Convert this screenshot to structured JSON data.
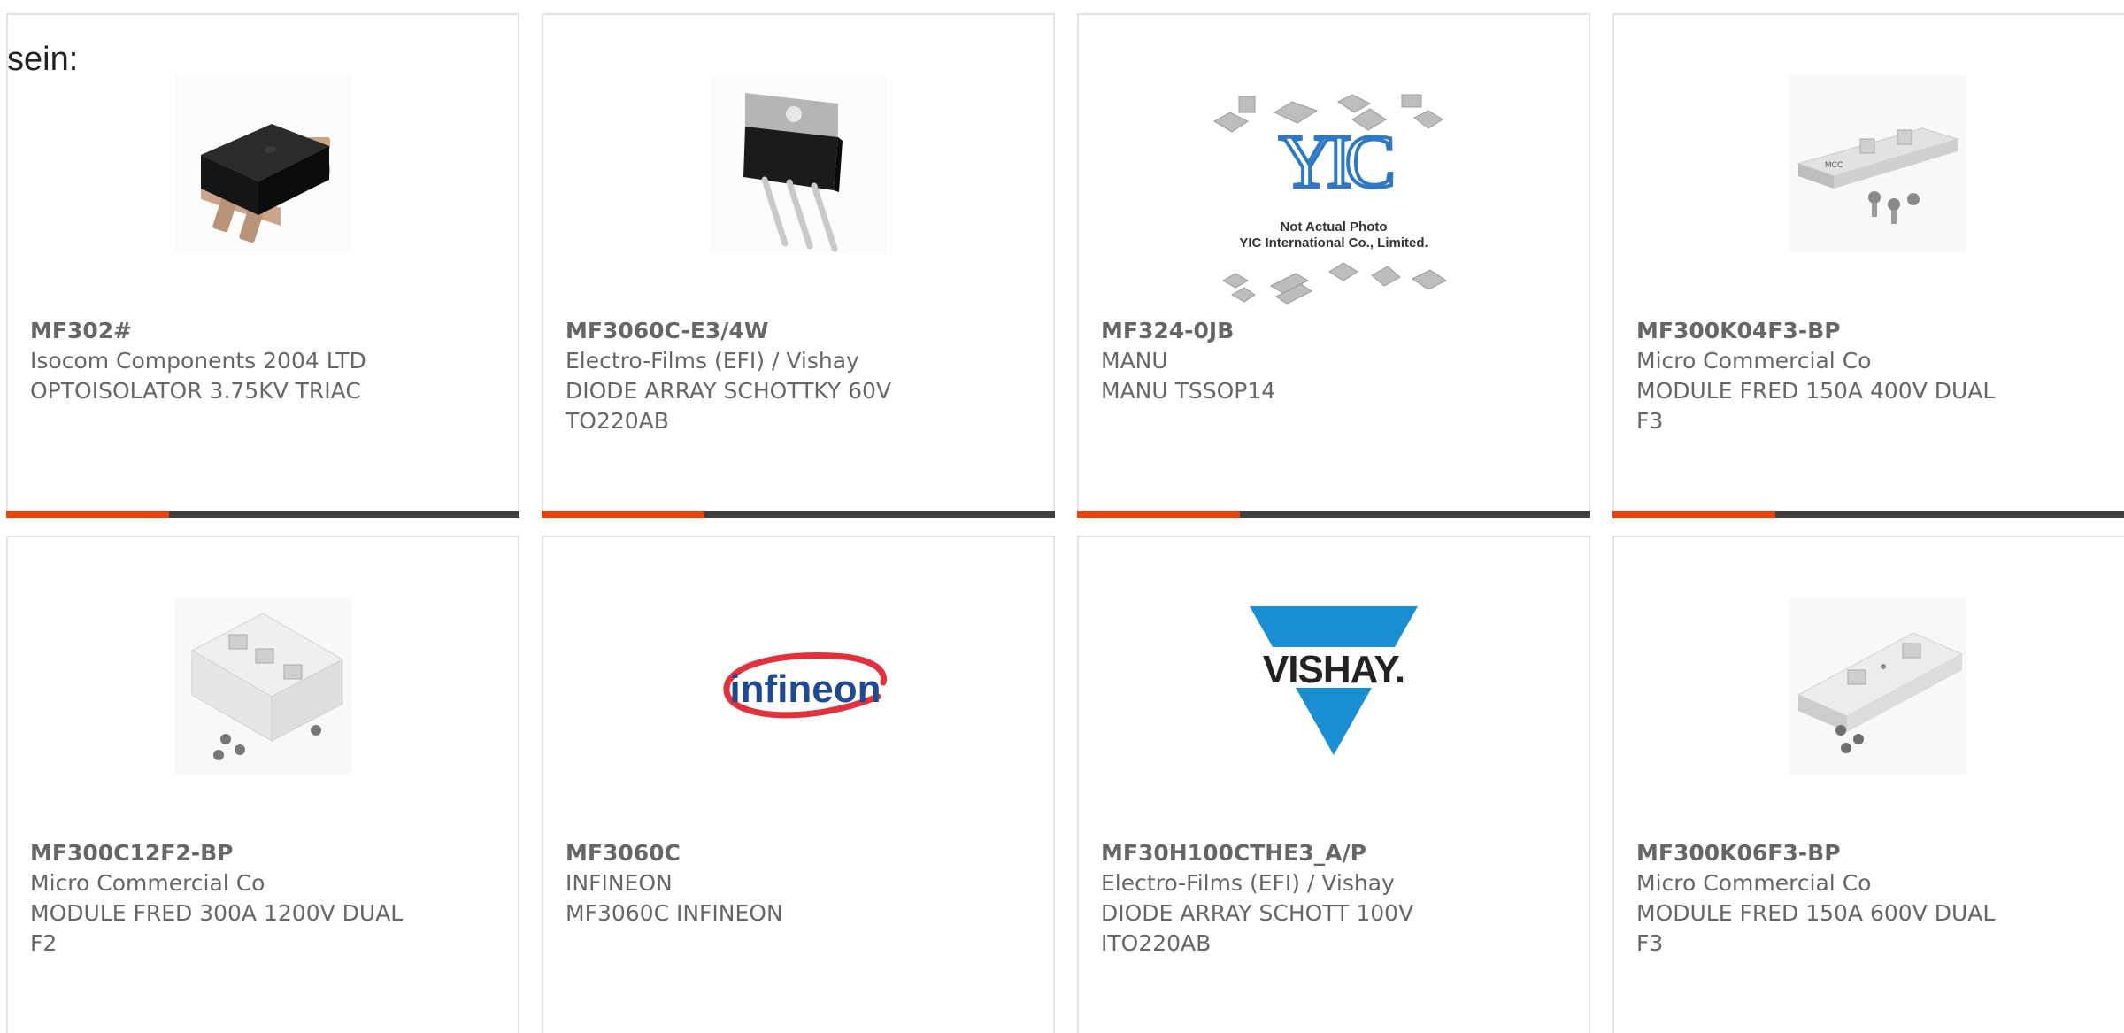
{
  "intro_text": "sein:",
  "colors": {
    "accent": "#e8430b",
    "bar": "#404040",
    "text": "#666666",
    "border": "#e3e3e3"
  },
  "products": [
    {
      "part_number": "MF302#",
      "manufacturer": "Isocom Components 2004 LTD",
      "description": "OPTOISOLATOR 3.75KV TRIAC",
      "image": "optoisolator-chip-image"
    },
    {
      "part_number": "MF3060C-E3/4W",
      "manufacturer": "Electro-Films (EFI) / Vishay",
      "description": "DIODE ARRAY SCHOTTKY 60V TO220AB",
      "image": "to220-diode-image"
    },
    {
      "part_number": "MF324-0JB",
      "manufacturer": "MANU",
      "description": "MANU TSSOP14",
      "image": "yic-placeholder-image",
      "placeholder_line1": "Not Actual Photo",
      "placeholder_line2": "YIC International Co., Limited."
    },
    {
      "part_number": "MF300K04F3-BP",
      "manufacturer": "Micro Commercial Co",
      "description": "MODULE FRED 150A 400V DUAL F3",
      "image": "module-f3-image"
    },
    {
      "part_number": "MF300C12F2-BP",
      "manufacturer": "Micro Commercial Co",
      "description": "MODULE FRED 300A 1200V DUAL F2",
      "image": "module-f2-image"
    },
    {
      "part_number": "MF3060C",
      "manufacturer": "INFINEON",
      "description": "MF3060C INFINEON",
      "image": "infineon-logo",
      "logo_text": "infineon"
    },
    {
      "part_number": "MF30H100CTHE3_A/P",
      "manufacturer": "Electro-Films (EFI) / Vishay",
      "description": "DIODE ARRAY SCHOTT 100V ITO220AB",
      "image": "vishay-logo",
      "logo_text": "VISHAY."
    },
    {
      "part_number": "MF300K06F3-BP",
      "manufacturer": "Micro Commercial Co",
      "description": "MODULE FRED 150A 600V DUAL F3",
      "image": "module-f3-image"
    }
  ]
}
